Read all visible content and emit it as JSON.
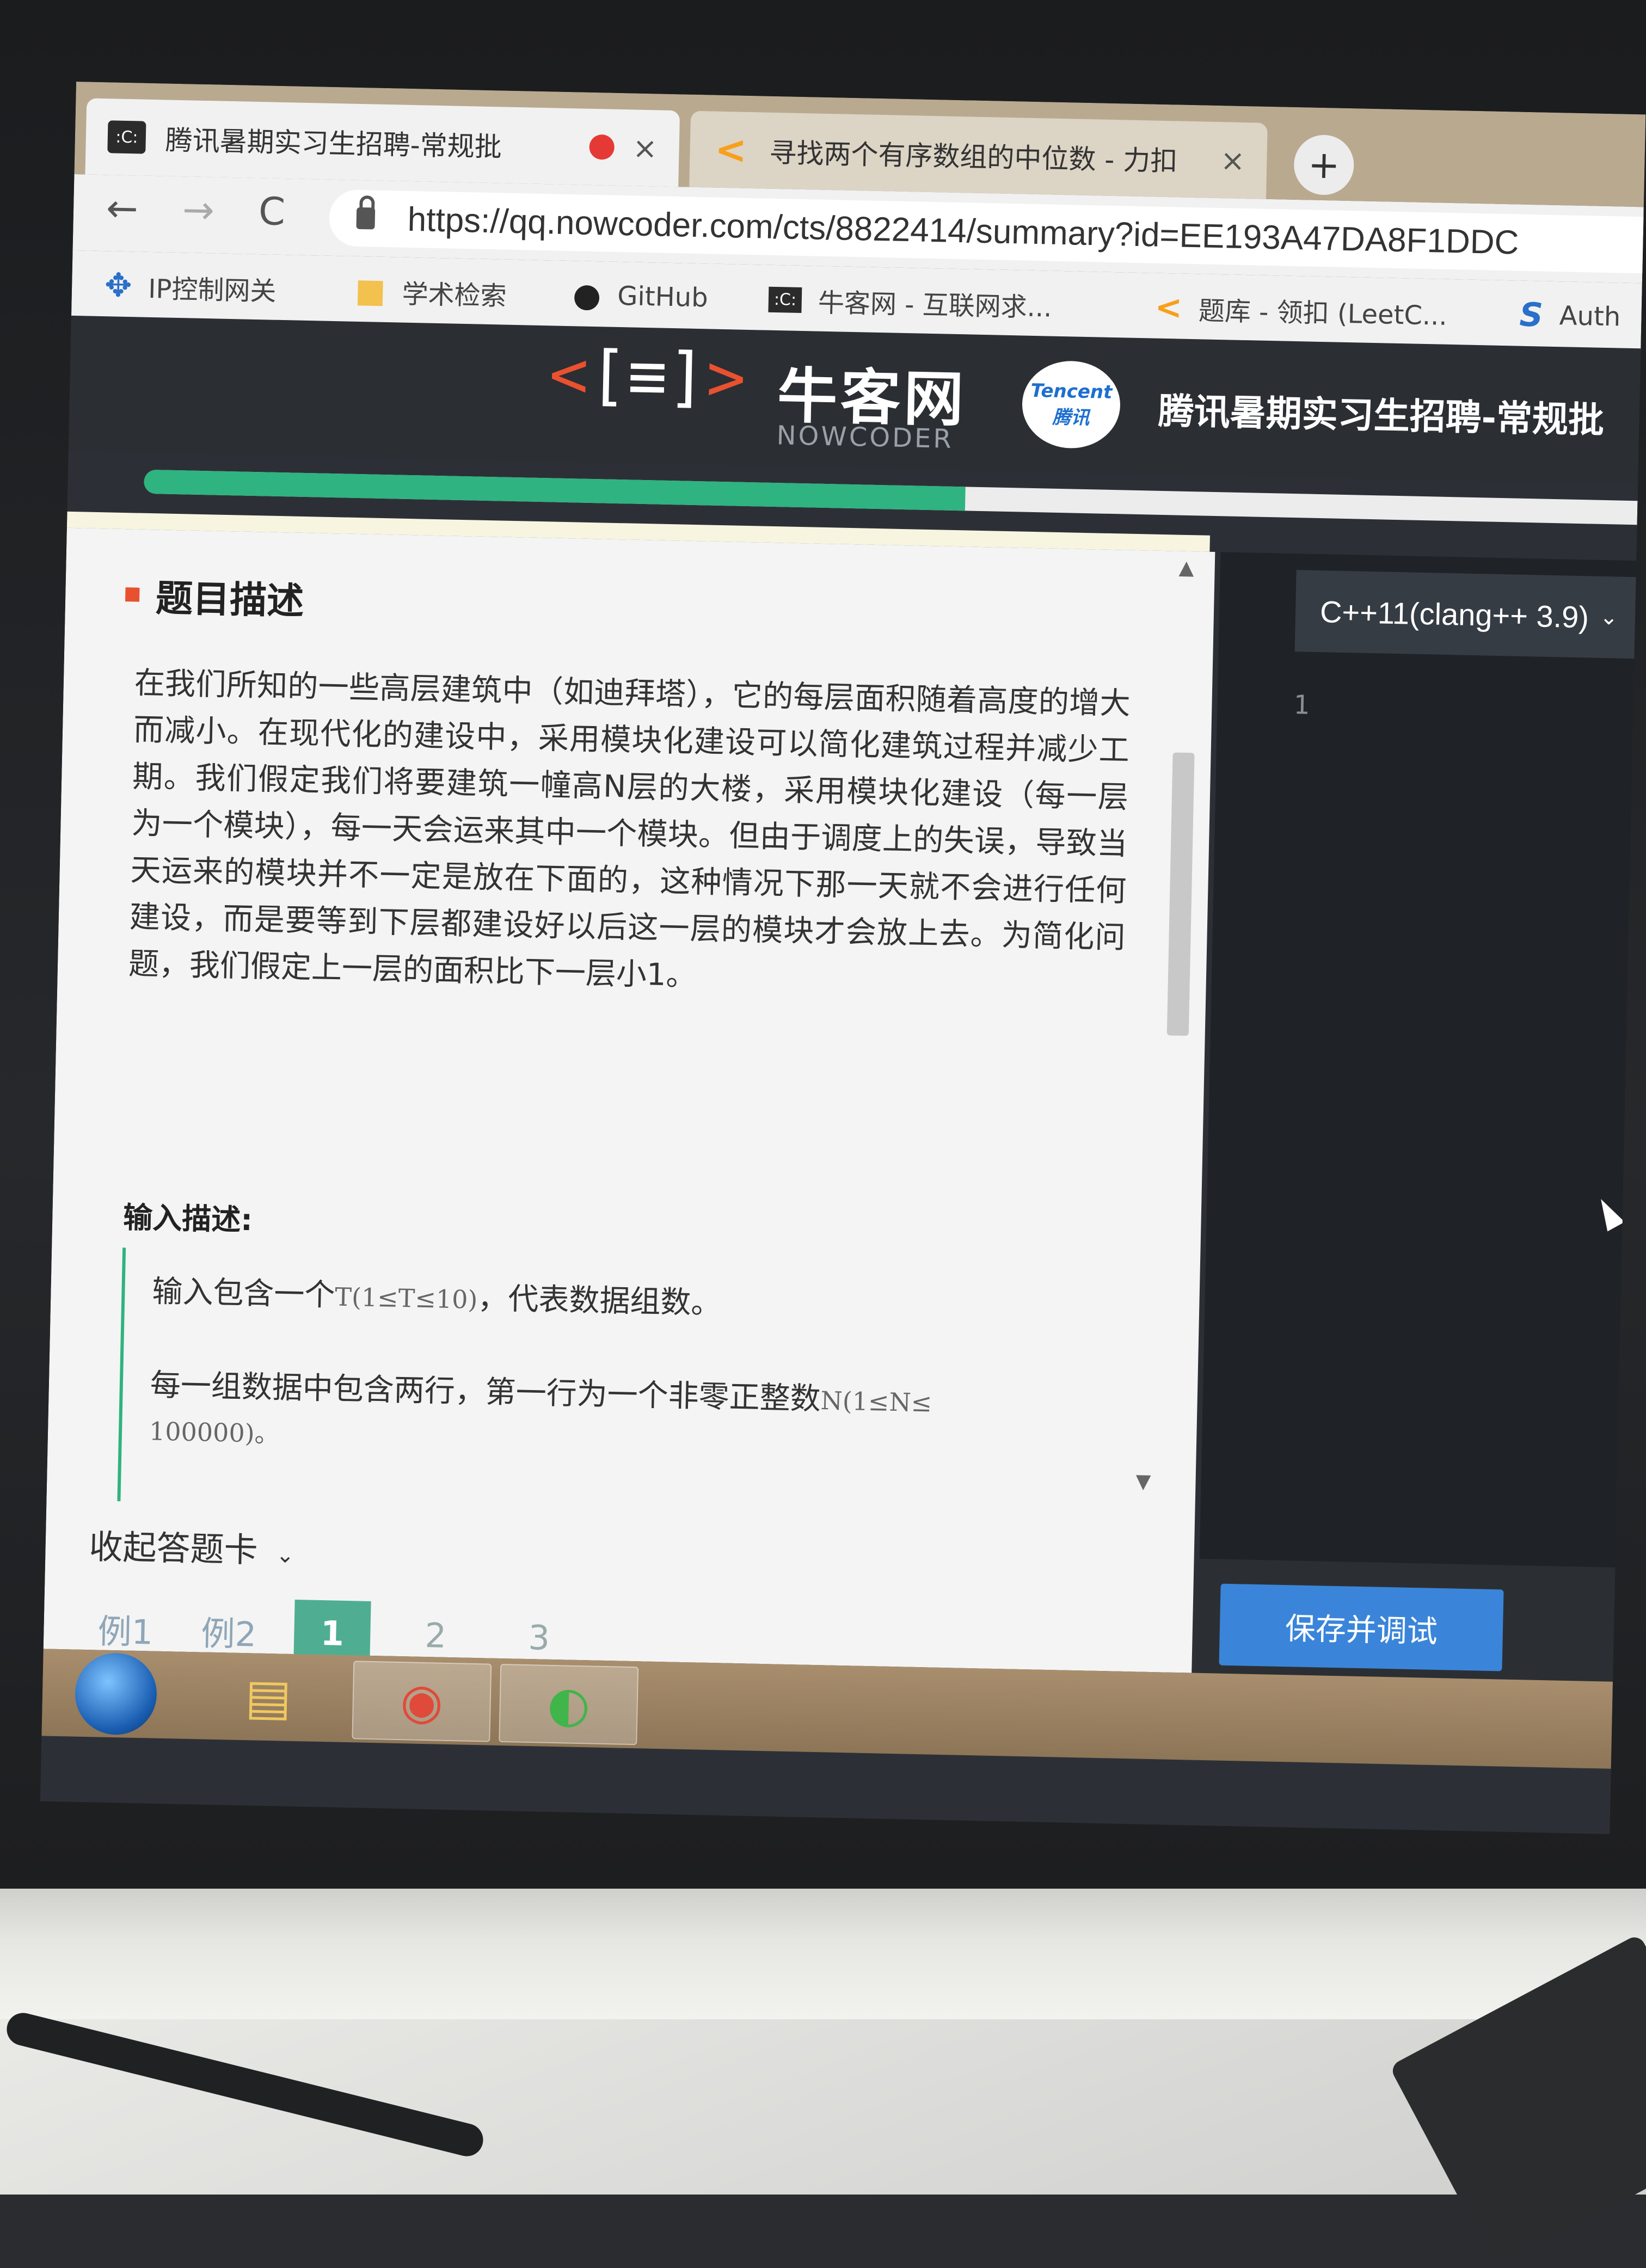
{
  "browser": {
    "tabs": [
      {
        "title": "腾讯暑期实习生招聘-常规批",
        "favicon": "nowcoder-icon",
        "recording": true,
        "active": true
      },
      {
        "title": "寻找两个有序数组的中位数 - 力扣",
        "favicon": "leetcode-icon",
        "active": false
      }
    ],
    "close_glyph": "×",
    "newtab_glyph": "+",
    "url": "https://qq.nowcoder.com/cts/8822414/summary?id=EE193A47DA8F1DDC",
    "nav": {
      "back": "←",
      "forward": "→",
      "reload": "C"
    },
    "bookmarks": [
      {
        "label": "IP控制网关",
        "icon": "network-icon"
      },
      {
        "label": "学术检索",
        "icon": "folder-icon"
      },
      {
        "label": "GitHub",
        "icon": "github-icon"
      },
      {
        "label": "牛客网 - 互联网求...",
        "icon": "nowcoder-icon"
      },
      {
        "label": "题库 - 领扣 (LeetC...",
        "icon": "leetcode-icon"
      },
      {
        "label": "Auth",
        "icon": "auth-icon"
      }
    ]
  },
  "site": {
    "logo_cn": "牛客网",
    "logo_en": "NOWCODER",
    "partner_badge": "Tencent 腾讯",
    "exam_title": "腾讯暑期实习生招聘-常规批",
    "progress": 0.55
  },
  "question": {
    "heading": "题目描述",
    "body": "在我们所知的一些高层建筑中（如迪拜塔），它的每层面积随着高度的增大而减小。在现代化的建设中，采用模块化建设可以简化建筑过程并减少工期。我们假定我们将要建筑一幢高N层的大楼，采用模块化建设（每一层为一个模块），每一天会运来其中一个模块。但由于调度上的失误，导致当天运来的模块并不一定是放在下面的，这种情况下那一天就不会进行任何建设，而是要等到下层都建设好以后这一层的模块才会放上去。为简化问题，我们假定上一层的面积比下一层小1。",
    "input_heading": "输入描述:",
    "input_line1_text": "输入包含一个",
    "input_line1_math": "T(1≤T≤10)",
    "input_line1_tail": "，代表数据组数。",
    "input_line2_text": "每一组数据中包含两行，第一行为一个非零正整数",
    "input_line2_math": "N(1≤N≤",
    "input_line2_cont": "100000)。"
  },
  "answer_card": {
    "toggle_label": "收起答题卡",
    "items": [
      "例1",
      "例2",
      "1",
      "2",
      "3"
    ],
    "current": "1"
  },
  "editor": {
    "language": "C++11(clang++ 3.9)",
    "line_numbers": [
      "1"
    ],
    "run_button": "保存并调试"
  },
  "taskbar": {
    "items": [
      "start-orb",
      "file-explorer-icon",
      "chrome-icon",
      "app-icon"
    ]
  }
}
